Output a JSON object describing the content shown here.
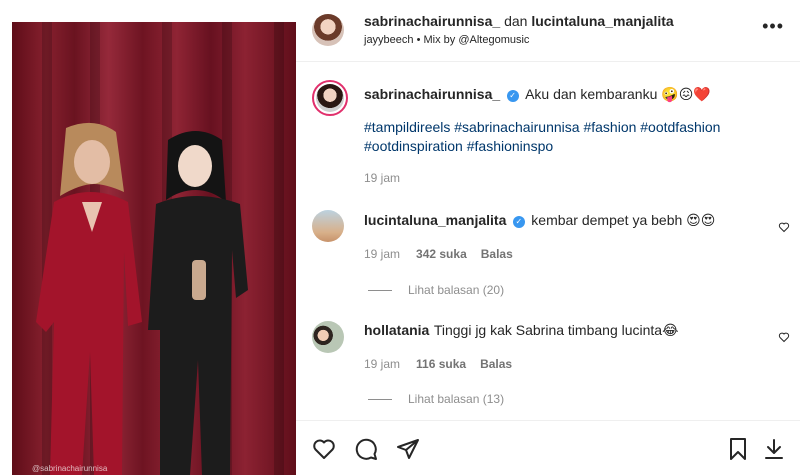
{
  "header": {
    "user1": "sabrinachairunnisa_",
    "and": "dan",
    "user2": "lucintaluna_manjalita",
    "subtitle": "jayybeech • Mix by @Altegomusic",
    "more": "•••"
  },
  "caption": {
    "username": "sabrinachairunnisa_",
    "text": "Aku dan kembaranku 🤪😖❤️",
    "hashtags": "#tampildireels #sabrinachairunnisa #fashion #ootdfashion #ootdinspiration #fashioninspo",
    "time": "19 jam"
  },
  "comments": [
    {
      "username": "lucintaluna_manjalita",
      "verified": true,
      "text": "kembar dempet ya bebh 😍😍",
      "time": "19 jam",
      "likes": "342 suka",
      "reply": "Balas",
      "view_replies": "Lihat balasan (20)"
    },
    {
      "username": "hollatania",
      "verified": false,
      "text": "Tinggi jg kak Sabrina timbang lucinta😂",
      "time": "19 jam",
      "likes": "116 suka",
      "reply": "Balas",
      "view_replies": "Lihat balasan (13)"
    }
  ],
  "video": {
    "watermark": "@sabrinachairunnisa"
  },
  "icons": {
    "like": "heart-icon",
    "comment": "comment-icon",
    "share": "send-icon",
    "save": "bookmark-icon",
    "download": "download-icon"
  },
  "colors": {
    "link": "#00376b",
    "verified": "#3897f0",
    "curtain": "#86202e"
  }
}
